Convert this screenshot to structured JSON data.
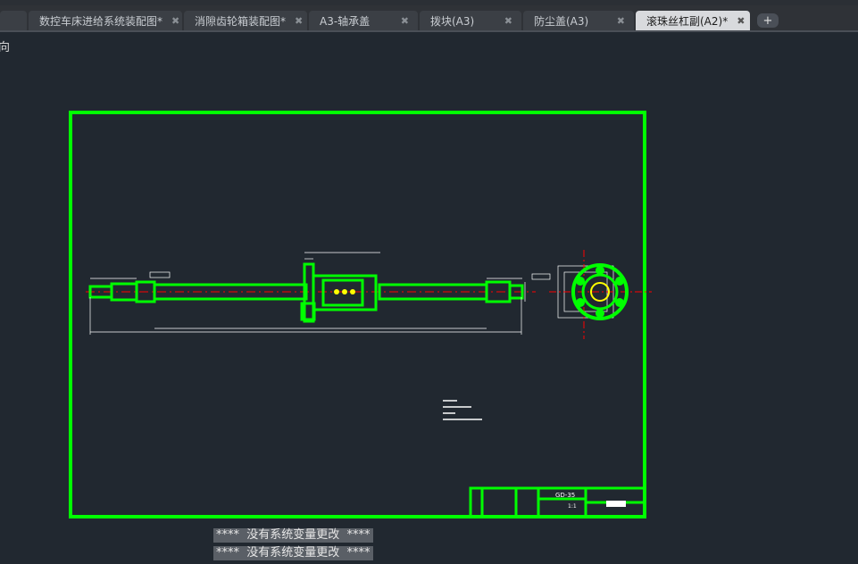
{
  "tabs": [
    {
      "label": "数控车床进给系统装配图*",
      "active": false
    },
    {
      "label": "消隙齿轮箱装配图*",
      "active": false
    },
    {
      "label": "A3-轴承盖",
      "active": false
    },
    {
      "label": "拨块(A3)",
      "active": false
    },
    {
      "label": "防尘盖(A3)",
      "active": false
    },
    {
      "label": "滚珠丝杠副(A2)*",
      "active": true
    }
  ],
  "viewport_label": "向",
  "title_block": {
    "part_no": "GD-35",
    "scale": "1:1"
  },
  "command_history": [
    "****  没有系统变量更改  ****",
    "****  没有系统变量更改  ****"
  ],
  "colors": {
    "border": "#00ff00",
    "centerline": "#ff0000",
    "dim": "#ffffff",
    "background": "#212830"
  }
}
